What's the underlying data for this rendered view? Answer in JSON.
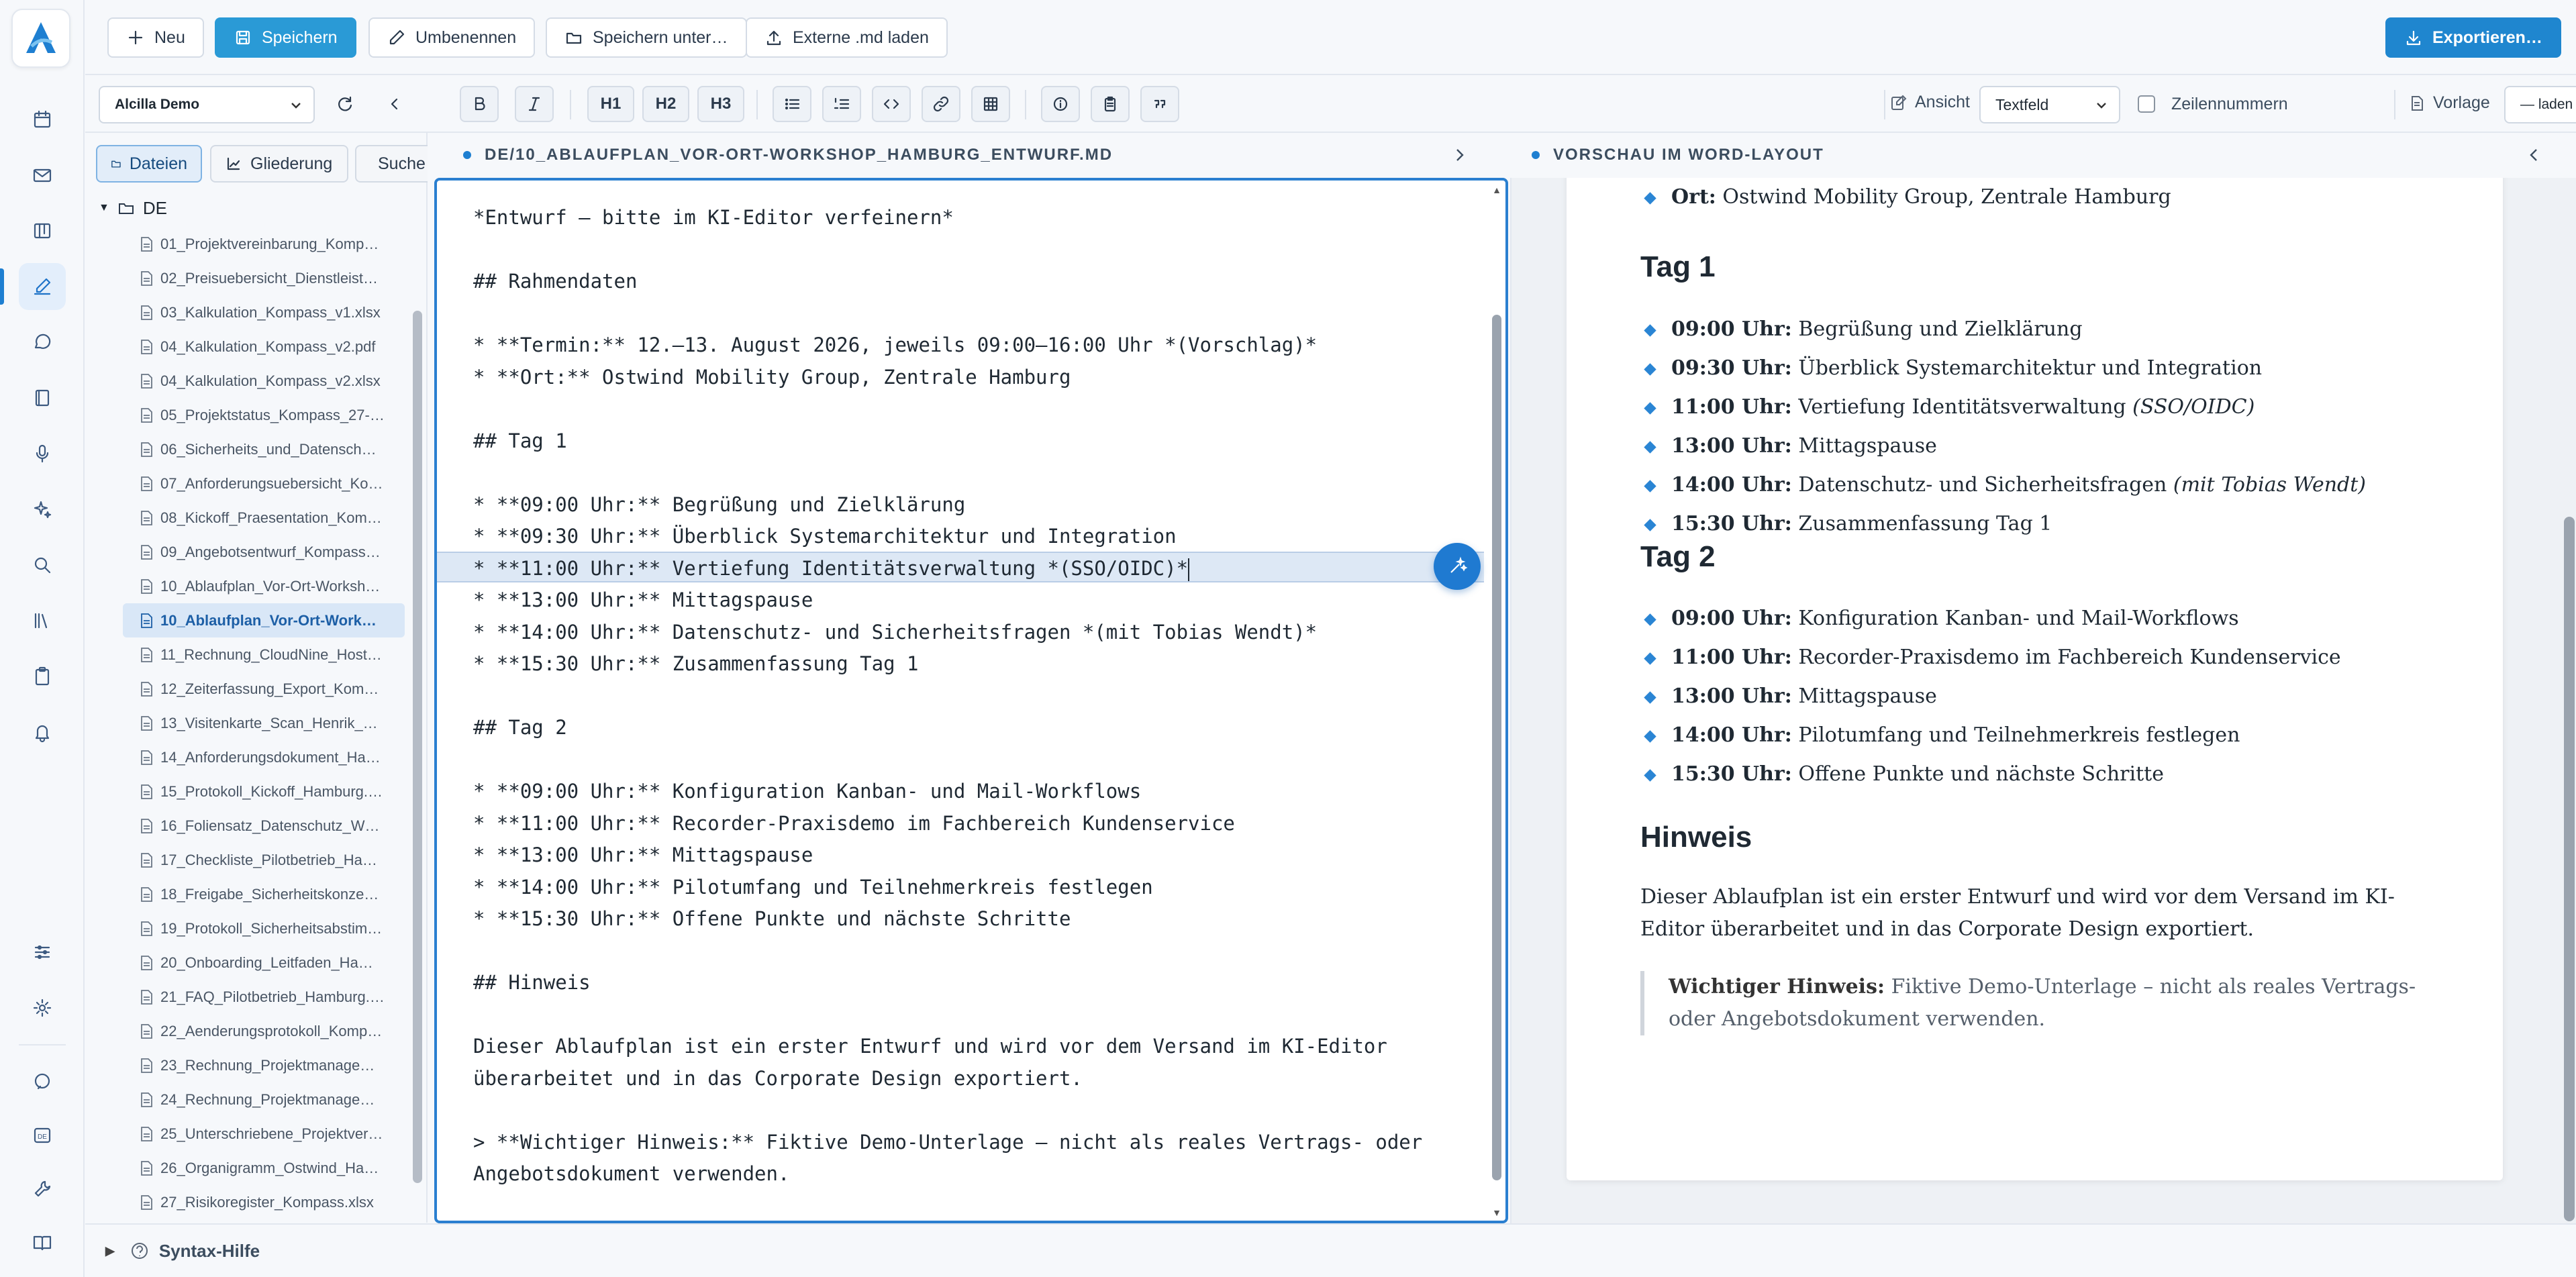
{
  "toolbar": {
    "new_label": "Neu",
    "save_label": "Speichern",
    "rename_label": "Umbenennen",
    "save_as_label": "Speichern unter…",
    "load_external_label": "Externe .md laden",
    "export_label": "Exportieren…"
  },
  "format": {
    "workspace_select": "Alcilla Demo",
    "h1": "H1",
    "h2": "H2",
    "h3": "H3",
    "view_label": "Ansicht",
    "view_select": "Textfeld",
    "line_numbers_label": "Zeilennummern",
    "template_label": "Vorlage",
    "template_select": "— laden —"
  },
  "sidebar": {
    "tabs": [
      "Dateien",
      "Gliederung",
      "Suche"
    ],
    "root_folder": "DE",
    "files": [
      "01_Projektvereinbarung_Komp…",
      "02_Preisuebersicht_Dienstleist…",
      "03_Kalkulation_Kompass_v1.xlsx",
      "04_Kalkulation_Kompass_v2.pdf",
      "04_Kalkulation_Kompass_v2.xlsx",
      "05_Projektstatus_Kompass_27-…",
      "06_Sicherheits_und_Datensch…",
      "07_Anforderungsuebersicht_Ko…",
      "08_Kickoff_Praesentation_Kom…",
      "09_Angebotsentwurf_Kompass…",
      "10_Ablaufplan_Vor-Ort-Worksh…",
      "10_Ablaufplan_Vor-Ort-Work…",
      "11_Rechnung_CloudNine_Host…",
      "12_Zeiterfassung_Export_Kom…",
      "13_Visitenkarte_Scan_Henrik_…",
      "14_Anforderungsdokument_Ha…",
      "15_Protokoll_Kickoff_Hamburg.…",
      "16_Foliensatz_Datenschutz_W…",
      "17_Checkliste_Pilotbetrieb_Ha…",
      "18_Freigabe_Sicherheitskonze…",
      "19_Protokoll_Sicherheitsabstim…",
      "20_Onboarding_Leitfaden_Ha…",
      "21_FAQ_Pilotbetrieb_Hamburg.…",
      "22_Aenderungsprotokoll_Komp…",
      "23_Rechnung_Projektmanage…",
      "24_Rechnung_Projektmanage…",
      "25_Unterschriebene_Projektver…",
      "26_Organigramm_Ostwind_Ha…",
      "27_Risikoregister_Kompass.xlsx"
    ],
    "active_index": 11
  },
  "editor": {
    "path": "DE/10_ABLAUFPLAN_VOR-ORT-WORKSHOP_HAMBURG_ENTWURF.MD",
    "lines": [
      "*Entwurf – bitte im KI-Editor verfeinern*",
      "",
      "## Rahmendaten",
      "",
      "* **Termin:** 12.–13. August 2026, jeweils 09:00–16:00 Uhr *(Vorschlag)*",
      "* **Ort:** Ostwind Mobility Group, Zentrale Hamburg",
      "",
      "## Tag 1",
      "",
      "* **09:00 Uhr:** Begrüßung und Zielklärung",
      "* **09:30 Uhr:** Überblick Systemarchitektur und Integration",
      "* **11:00 Uhr:** Vertiefung Identitätsverwaltung *(SSO/OIDC)*",
      "* **13:00 Uhr:** Mittagspause",
      "* **14:00 Uhr:** Datenschutz- und Sicherheitsfragen *(mit Tobias Wendt)*",
      "* **15:30 Uhr:** Zusammenfassung Tag 1",
      "",
      "## Tag 2",
      "",
      "* **09:00 Uhr:** Konfiguration Kanban- und Mail-Workflows",
      "* **11:00 Uhr:** Recorder-Praxisdemo im Fachbereich Kundenservice",
      "* **13:00 Uhr:** Mittagspause",
      "* **14:00 Uhr:** Pilotumfang und Teilnehmerkreis festlegen",
      "* **15:30 Uhr:** Offene Punkte und nächste Schritte",
      "",
      "## Hinweis",
      "",
      "Dieser Ablaufplan ist ein erster Entwurf und wird vor dem Versand im KI-Editor",
      "überarbeitet und in das Corporate Design exportiert.",
      "",
      "> **Wichtiger Hinweis:** Fiktive Demo-Unterlage – nicht als reales Vertrags- oder",
      "Angebotsdokument verwenden."
    ],
    "current_line": 11
  },
  "preview": {
    "header": "VORSCHAU IM WORD-LAYOUT",
    "ort_label": "Ort:",
    "ort_value": "Ostwind Mobility Group, Zentrale Hamburg",
    "tag1_title": "Tag 1",
    "tag1": [
      {
        "time": "09:00 Uhr:",
        "text": "Begrüßung und Zielklärung",
        "em": ""
      },
      {
        "time": "09:30 Uhr:",
        "text": "Überblick Systemarchitektur und Integration",
        "em": ""
      },
      {
        "time": "11:00 Uhr:",
        "text": "Vertiefung Identitätsverwaltung ",
        "em": "(SSO/OIDC)"
      },
      {
        "time": "13:00 Uhr:",
        "text": "Mittagspause",
        "em": ""
      },
      {
        "time": "14:00 Uhr:",
        "text": "Datenschutz- und Sicherheitsfragen ",
        "em": "(mit Tobias Wendt)"
      },
      {
        "time": "15:30 Uhr:",
        "text": "Zusammenfassung Tag 1",
        "em": ""
      }
    ],
    "tag2_title": "Tag 2",
    "tag2": [
      {
        "time": "09:00 Uhr:",
        "text": "Konfiguration Kanban- und Mail-Workflows",
        "em": ""
      },
      {
        "time": "11:00 Uhr:",
        "text": "Recorder-Praxisdemo im Fachbereich Kundenservice",
        "em": ""
      },
      {
        "time": "13:00 Uhr:",
        "text": "Mittagspause",
        "em": ""
      },
      {
        "time": "14:00 Uhr:",
        "text": "Pilotumfang und Teilnehmerkreis festlegen",
        "em": ""
      },
      {
        "time": "15:30 Uhr:",
        "text": "Offene Punkte und nächste Schritte",
        "em": ""
      }
    ],
    "hinweis_title": "Hinweis",
    "hinweis_text": "Dieser Ablaufplan ist ein erster Entwurf und wird vor dem Versand im KI-Editor überarbeitet und in das Corporate Design exportiert.",
    "quote_label": "Wichtiger Hinweis:",
    "quote_text": " Fiktive Demo-Unterlage – nicht als reales Vertrags- oder Angebotsdokument verwenden."
  },
  "bottom": {
    "syntax_help": "Syntax-Hilfe"
  },
  "colors": {
    "accent": "#1f86cf",
    "editor_border": "#2a7fd0",
    "highlight": "#dde8f5"
  }
}
